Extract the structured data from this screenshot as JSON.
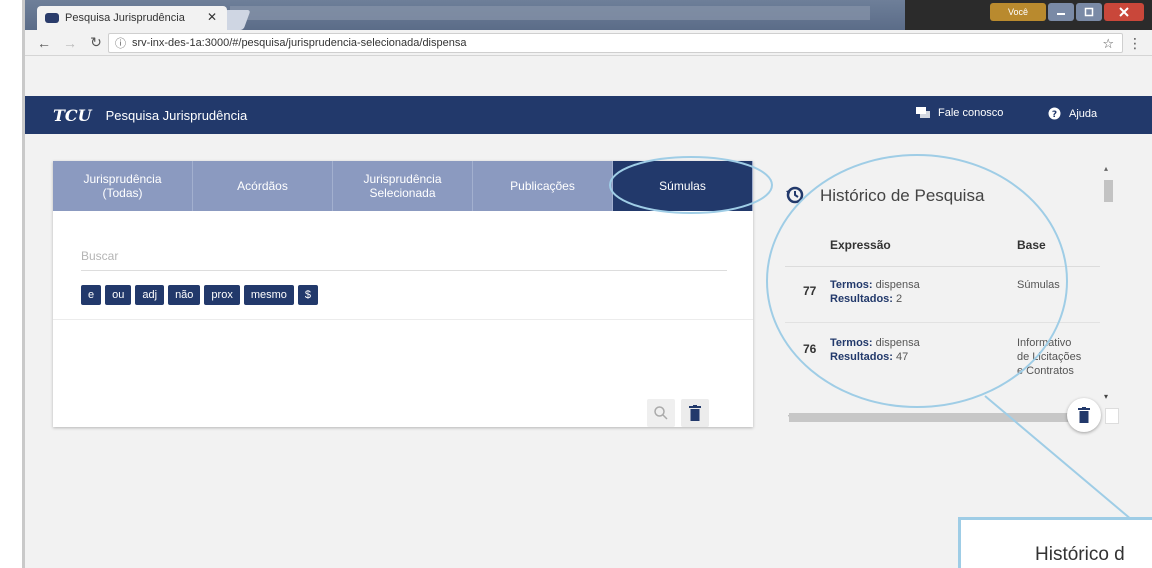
{
  "browser": {
    "tab_title": "Pesquisa Jurisprudência",
    "tab_close": "✕",
    "url": "srv-inx-des-1a:3000/#/pesquisa/jurisprudencia-selecionada/dispensa",
    "user_label": "Você"
  },
  "header": {
    "logo": "TCU",
    "title": "Pesquisa Jurisprudência",
    "contact_label": "Fale conosco",
    "help_label": "Ajuda",
    "background": "#22396b"
  },
  "tabs": [
    {
      "line1": "Jurisprudência",
      "line2": "(Todas)"
    },
    {
      "line1": "Acórdãos",
      "line2": ""
    },
    {
      "line1": "Jurisprudência",
      "line2": "Selecionada"
    },
    {
      "line1": "Publicações",
      "line2": ""
    },
    {
      "line1": "Súmulas",
      "line2": ""
    }
  ],
  "search": {
    "placeholder": "Buscar",
    "operators": [
      "e",
      "ou",
      "adj",
      "não",
      "prox",
      "mesmo",
      "$"
    ]
  },
  "history": {
    "title": "Histórico de Pesquisa",
    "col_expression": "Expressão",
    "col_base": "Base",
    "rows": [
      {
        "num": "77",
        "terms_label": "Termos:",
        "terms": "dispensa",
        "results_label": "Resultados:",
        "results": "2",
        "base_l1": "Súmulas",
        "base_l2": "",
        "base_l3": ""
      },
      {
        "num": "76",
        "terms_label": "Termos:",
        "terms": "dispensa",
        "results_label": "Resultados:",
        "results": "47",
        "base_l1": "Informativo",
        "base_l2": "de Licitações",
        "base_l3": "e Contratos"
      }
    ]
  },
  "annotation": {
    "callout_text": "Histórico d",
    "color": "#9fcde6"
  }
}
